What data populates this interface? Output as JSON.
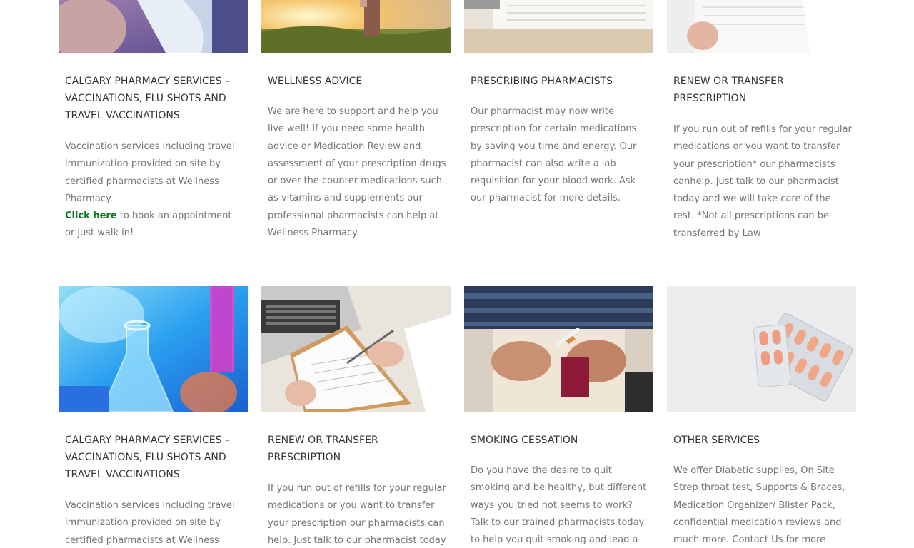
{
  "row1": [
    {
      "title": "CALGARY PHARMACY SERVICES – VACCINATIONS, FLU SHOTS AND TRAVEL VACCINATIONS",
      "desc": "Vaccination services including travel immunization provided on site by certified pharmacists at Wellness Pharmacy.",
      "link": "Click here",
      "desc_after": " to book an appointment or just walk in!"
    },
    {
      "title": "WELLNESS ADVICE",
      "desc": "We are here to support and help you live well! If you need some health advice or Medication Review and assessment of your prescription drugs or over the counter medications such as vitamins and supplements our professional pharmacists can help at Wellness Pharmacy."
    },
    {
      "title": "PRESCRIBING PHARMACISTS",
      "desc": "Our pharmacist may now write prescription for certain medications by saving you time and energy. Our pharmacist can also write a lab requisition for your blood work. Ask our pharmacist for more details."
    },
    {
      "title": "RENEW OR TRANSFER PRESCRIPTION",
      "desc": "If you run out of refills for your regular medications or you want to transfer your prescription* our pharmacists canhelp. Just talk to our pharmacist today and we will take care of the rest. *Not all prescriptions can be transferred by Law"
    }
  ],
  "row2": [
    {
      "title": "CALGARY PHARMACY SERVICES – VACCINATIONS, FLU SHOTS AND TRAVEL VACCINATIONS",
      "desc": "Vaccination services including travel immunization provided on site by certified pharmacists at Wellness"
    },
    {
      "title": "RENEW OR TRANSFER PRESCRIPTION",
      "desc": "If you run out of refills for your regular medications or you want to transfer your prescription our pharmacists can help.  Just talk to our pharmacist today"
    },
    {
      "title": "SMOKING CESSATION",
      "desc": "Do you have the desire to quit smoking and be healthy, but different ways you tried not seems to work? Talk to our trained pharmacists today to help you quit smoking and lead a healthy long"
    },
    {
      "title": "OTHER SERVICES",
      "desc": "We offer Diabetic supplies, On Site Strep throat test, Supports & Braces, Medication Organizer/ Blister Pack, confidential medication reviews and much more. Contact Us for more"
    }
  ],
  "colors": {
    "link": "#0a7a1f",
    "title": "#333333",
    "body": "#747474"
  }
}
